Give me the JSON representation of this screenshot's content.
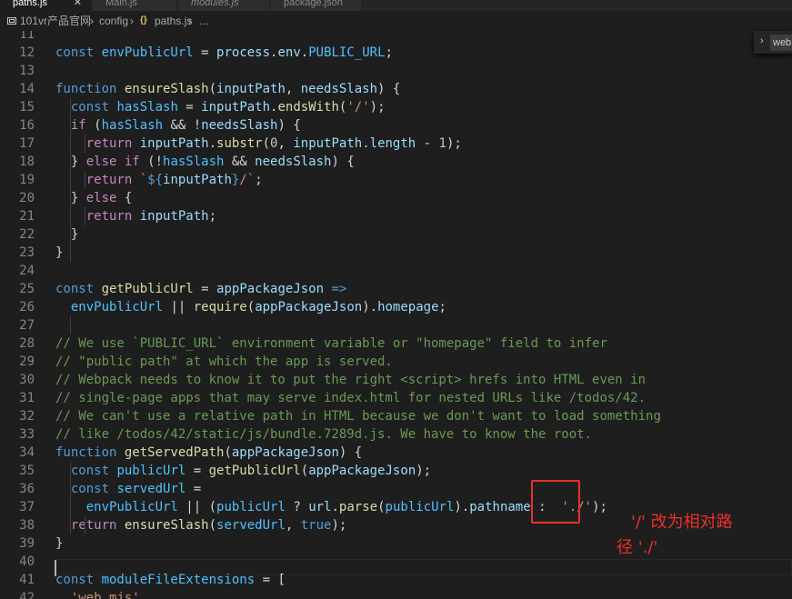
{
  "tabs": [
    {
      "label": "paths.js",
      "active": true,
      "close": "✕"
    },
    {
      "label": "Main.js",
      "active": false
    },
    {
      "label": "modules.js",
      "active": false,
      "italic": true
    },
    {
      "label": "package.json",
      "active": false
    }
  ],
  "breadcrumb": {
    "items": [
      "101vr产品官网",
      "config",
      "paths.js",
      "..."
    ],
    "separator": "›"
  },
  "find_widget": {
    "text": "web"
  },
  "editor": {
    "current_line": 40,
    "lines": [
      {
        "n": "11",
        "t": [
          [
            "",
            ""
          ]
        ]
      },
      {
        "n": "12",
        "t": [
          [
            "kw",
            "const "
          ],
          [
            "cn",
            "envPublicUrl"
          ],
          [
            "op",
            " = "
          ],
          [
            "var",
            "process"
          ],
          [
            "op",
            "."
          ],
          [
            "var",
            "env"
          ],
          [
            "op",
            "."
          ],
          [
            "cn",
            "PUBLIC_URL"
          ],
          [
            "op",
            ";"
          ]
        ]
      },
      {
        "n": "13",
        "t": [
          [
            "",
            ""
          ]
        ]
      },
      {
        "n": "14",
        "t": [
          [
            "kw",
            "function "
          ],
          [
            "fn",
            "ensureSlash"
          ],
          [
            "op",
            "("
          ],
          [
            "var",
            "inputPath"
          ],
          [
            "op",
            ", "
          ],
          [
            "var",
            "needsSlash"
          ],
          [
            "op",
            ") {"
          ]
        ]
      },
      {
        "n": "15",
        "t": [
          [
            "op",
            "  "
          ],
          [
            "kw",
            "const "
          ],
          [
            "cn",
            "hasSlash"
          ],
          [
            "op",
            " = "
          ],
          [
            "var",
            "inputPath"
          ],
          [
            "op",
            "."
          ],
          [
            "fn",
            "endsWith"
          ],
          [
            "op",
            "("
          ],
          [
            "str",
            "'/'"
          ],
          [
            "op",
            ");"
          ]
        ]
      },
      {
        "n": "16",
        "t": [
          [
            "op",
            "  "
          ],
          [
            "kw2",
            "if "
          ],
          [
            "op",
            "("
          ],
          [
            "cn",
            "hasSlash"
          ],
          [
            "op",
            " && !"
          ],
          [
            "var",
            "needsSlash"
          ],
          [
            "op",
            ") {"
          ]
        ]
      },
      {
        "n": "17",
        "t": [
          [
            "op",
            "    "
          ],
          [
            "kw2",
            "return "
          ],
          [
            "var",
            "inputPath"
          ],
          [
            "op",
            "."
          ],
          [
            "fn",
            "substr"
          ],
          [
            "op",
            "("
          ],
          [
            "num",
            "0"
          ],
          [
            "op",
            ", "
          ],
          [
            "var",
            "inputPath"
          ],
          [
            "op",
            "."
          ],
          [
            "var",
            "length"
          ],
          [
            "op",
            " - "
          ],
          [
            "num",
            "1"
          ],
          [
            "op",
            ");"
          ]
        ]
      },
      {
        "n": "18",
        "t": [
          [
            "op",
            "  } "
          ],
          [
            "kw2",
            "else if "
          ],
          [
            "op",
            "(!"
          ],
          [
            "cn",
            "hasSlash"
          ],
          [
            "op",
            " && "
          ],
          [
            "var",
            "needsSlash"
          ],
          [
            "op",
            ") {"
          ]
        ]
      },
      {
        "n": "19",
        "t": [
          [
            "op",
            "    "
          ],
          [
            "kw2",
            "return "
          ],
          [
            "str",
            "`"
          ],
          [
            "kw",
            "${"
          ],
          [
            "var",
            "inputPath"
          ],
          [
            "kw",
            "}"
          ],
          [
            "str",
            "/`"
          ],
          [
            "op",
            ";"
          ]
        ]
      },
      {
        "n": "20",
        "t": [
          [
            "op",
            "  } "
          ],
          [
            "kw2",
            "else "
          ],
          [
            "op",
            "{"
          ]
        ]
      },
      {
        "n": "21",
        "t": [
          [
            "op",
            "    "
          ],
          [
            "kw2",
            "return "
          ],
          [
            "var",
            "inputPath"
          ],
          [
            "op",
            ";"
          ]
        ]
      },
      {
        "n": "22",
        "t": [
          [
            "op",
            "  }"
          ]
        ]
      },
      {
        "n": "23",
        "t": [
          [
            "op",
            "}"
          ]
        ]
      },
      {
        "n": "24",
        "t": [
          [
            "",
            ""
          ]
        ]
      },
      {
        "n": "25",
        "t": [
          [
            "kw",
            "const "
          ],
          [
            "fn",
            "getPublicUrl"
          ],
          [
            "op",
            " = "
          ],
          [
            "var",
            "appPackageJson"
          ],
          [
            "kw",
            " =>"
          ]
        ]
      },
      {
        "n": "26",
        "t": [
          [
            "op",
            "  "
          ],
          [
            "cn",
            "envPublicUrl"
          ],
          [
            "op",
            " || "
          ],
          [
            "fn",
            "require"
          ],
          [
            "op",
            "("
          ],
          [
            "var",
            "appPackageJson"
          ],
          [
            "op",
            ")."
          ],
          [
            "var",
            "homepage"
          ],
          [
            "op",
            ";"
          ]
        ]
      },
      {
        "n": "27",
        "t": [
          [
            "",
            ""
          ]
        ]
      },
      {
        "n": "28",
        "t": [
          [
            "cm",
            "// We use `PUBLIC_URL` environment variable or \"homepage\" field to infer"
          ]
        ]
      },
      {
        "n": "29",
        "t": [
          [
            "cm",
            "// \"public path\" at which the app is served."
          ]
        ]
      },
      {
        "n": "30",
        "t": [
          [
            "cm",
            "// Webpack needs to know it to put the right <script> hrefs into HTML even in"
          ]
        ]
      },
      {
        "n": "31",
        "t": [
          [
            "cm",
            "// single-page apps that may serve index.html for nested URLs like /todos/42."
          ]
        ]
      },
      {
        "n": "32",
        "t": [
          [
            "cm",
            "// We can't use a relative path in HTML because we don't want to load something"
          ]
        ]
      },
      {
        "n": "33",
        "t": [
          [
            "cm",
            "// like /todos/42/static/js/bundle.7289d.js. We have to know the root."
          ]
        ]
      },
      {
        "n": "34",
        "t": [
          [
            "kw",
            "function "
          ],
          [
            "fn",
            "getServedPath"
          ],
          [
            "op",
            "("
          ],
          [
            "var",
            "appPackageJson"
          ],
          [
            "op",
            ") {"
          ]
        ]
      },
      {
        "n": "35",
        "t": [
          [
            "op",
            "  "
          ],
          [
            "kw",
            "const "
          ],
          [
            "cn",
            "publicUrl"
          ],
          [
            "op",
            " = "
          ],
          [
            "fn",
            "getPublicUrl"
          ],
          [
            "op",
            "("
          ],
          [
            "var",
            "appPackageJson"
          ],
          [
            "op",
            ");"
          ]
        ]
      },
      {
        "n": "36",
        "t": [
          [
            "op",
            "  "
          ],
          [
            "kw",
            "const "
          ],
          [
            "cn",
            "servedUrl"
          ],
          [
            "op",
            " ="
          ]
        ]
      },
      {
        "n": "37",
        "t": [
          [
            "op",
            "    "
          ],
          [
            "cn",
            "envPublicUrl"
          ],
          [
            "op",
            " || ("
          ],
          [
            "cn",
            "publicUrl"
          ],
          [
            "op",
            " ? "
          ],
          [
            "var",
            "url"
          ],
          [
            "op",
            "."
          ],
          [
            "fn",
            "parse"
          ],
          [
            "op",
            "("
          ],
          [
            "cn",
            "publicUrl"
          ],
          [
            "op",
            ")."
          ],
          [
            "var",
            "pathname"
          ],
          [
            "op",
            " :  "
          ],
          [
            "str",
            "'./'"
          ],
          [
            "op",
            ");"
          ]
        ]
      },
      {
        "n": "38",
        "t": [
          [
            "op",
            "  "
          ],
          [
            "kw2",
            "return "
          ],
          [
            "fn",
            "ensureSlash"
          ],
          [
            "op",
            "("
          ],
          [
            "cn",
            "servedUrl"
          ],
          [
            "op",
            ", "
          ],
          [
            "kw",
            "true"
          ],
          [
            "op",
            ");"
          ]
        ]
      },
      {
        "n": "39",
        "t": [
          [
            "op",
            "}"
          ]
        ]
      },
      {
        "n": "40",
        "t": [
          [
            "",
            ""
          ]
        ]
      },
      {
        "n": "41",
        "t": [
          [
            "kw",
            "const "
          ],
          [
            "cn",
            "moduleFileExtensions"
          ],
          [
            "op",
            " = ["
          ]
        ]
      },
      {
        "n": "42",
        "t": [
          [
            "op",
            "  "
          ],
          [
            "str",
            "'web.mjs'"
          ],
          [
            "op",
            ","
          ]
        ]
      }
    ]
  },
  "annotation": {
    "line1": "'/'  改为相对路",
    "line2": "径  './'"
  },
  "colors": {
    "annotation": "#e8312a",
    "background": "#1e1e1e"
  }
}
